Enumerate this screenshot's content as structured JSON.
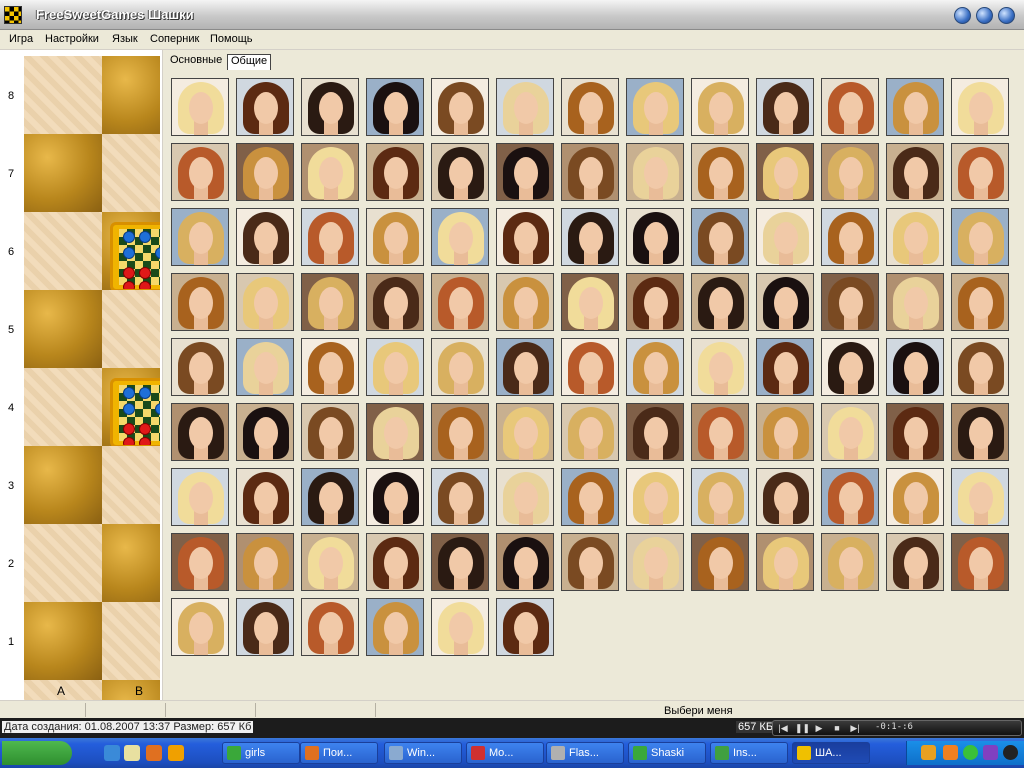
{
  "window": {
    "title": "FreeSweetGames Шашки"
  },
  "menu": [
    "Игра",
    "Настройки",
    "Язык",
    "Соперник",
    "Помощь"
  ],
  "board": {
    "ranks": [
      "8",
      "7",
      "6",
      "5",
      "4",
      "3",
      "2",
      "1"
    ],
    "files": [
      "A",
      "B"
    ]
  },
  "tabs": [
    "Основные",
    "Общие"
  ],
  "active_tab": "Общие",
  "grid": {
    "rows": 9,
    "cols": 13,
    "count": 110
  },
  "status": {
    "text": "Выбери меня"
  },
  "infobar": {
    "file_info": "Дата создания: 01.08.2007 13:37 Размер: 657 Кб",
    "size": "657 КБ",
    "media_time": "-0:1-:6"
  },
  "taskbar": {
    "tasks": [
      "girls",
      "Пои...",
      "Win...",
      "Mo...",
      "Flas...",
      "Shaski",
      "Ins...",
      "ША..."
    ],
    "task_colors": [
      "#3aa83a",
      "#e07020",
      "#8aaad0",
      "#d03030",
      "#b0b0b0",
      "#3aa83a",
      "#40a040",
      "#f0c000"
    ]
  },
  "colors": {
    "hair": [
      "#f1dc9a",
      "#e8c87a",
      "#2a1a12",
      "#4a2a18",
      "#7a4a22",
      "#c9913e",
      "#a8621e",
      "#5c2a12",
      "#d8b060",
      "#1a1010",
      "#b85a2a",
      "#e9d29a"
    ],
    "bg": [
      "#f4ece0",
      "#d8c8b0",
      "#9ab0c8",
      "#c8b090",
      "#e8e0d0",
      "#b09070",
      "#d0d8e0",
      "#806048"
    ]
  }
}
